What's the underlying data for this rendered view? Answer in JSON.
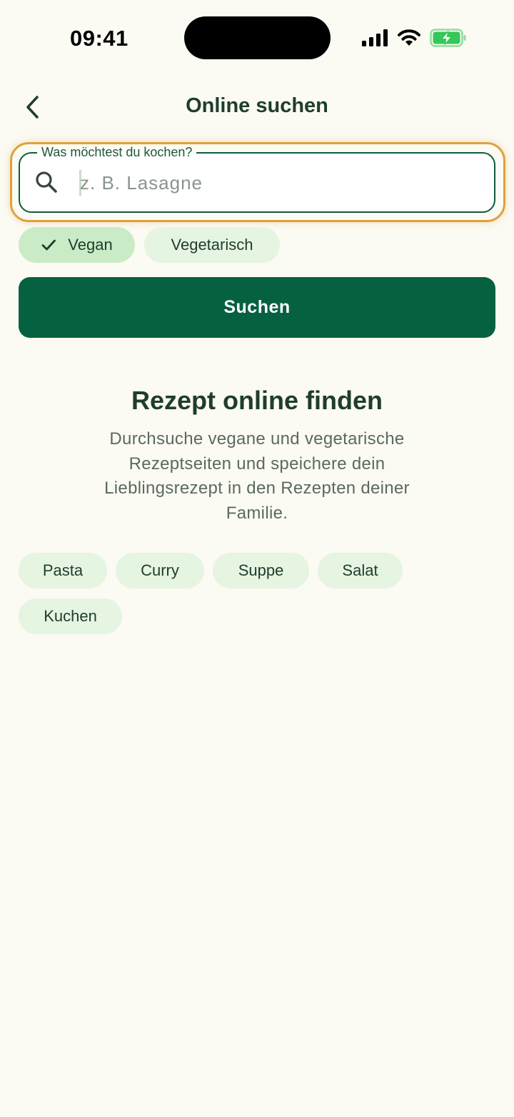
{
  "status_bar": {
    "time": "09:41"
  },
  "header": {
    "title": "Online suchen"
  },
  "search": {
    "label": "Was möchtest du kochen?",
    "placeholder": "z. B. Lasagne",
    "value": ""
  },
  "filters": [
    {
      "label": "Vegan",
      "selected": true
    },
    {
      "label": "Vegetarisch",
      "selected": false
    }
  ],
  "search_button": {
    "label": "Suchen"
  },
  "empty_state": {
    "title": "Rezept online finden",
    "description": "Durchsuche vegane und vegetarische Rezeptseiten und speichere dein Lieblingsrezept in den Rezepten deiner Familie."
  },
  "suggestions": [
    {
      "label": "Pasta"
    },
    {
      "label": "Curry"
    },
    {
      "label": "Suppe"
    },
    {
      "label": "Salat"
    },
    {
      "label": "Kuchen"
    }
  ],
  "colors": {
    "background": "#fbfaf3",
    "primary": "#066141",
    "chip": "#e6f4e2",
    "chip_selected": "#c9ebc6",
    "focus_ring": "#e0a13c",
    "battery": "#34c759"
  }
}
